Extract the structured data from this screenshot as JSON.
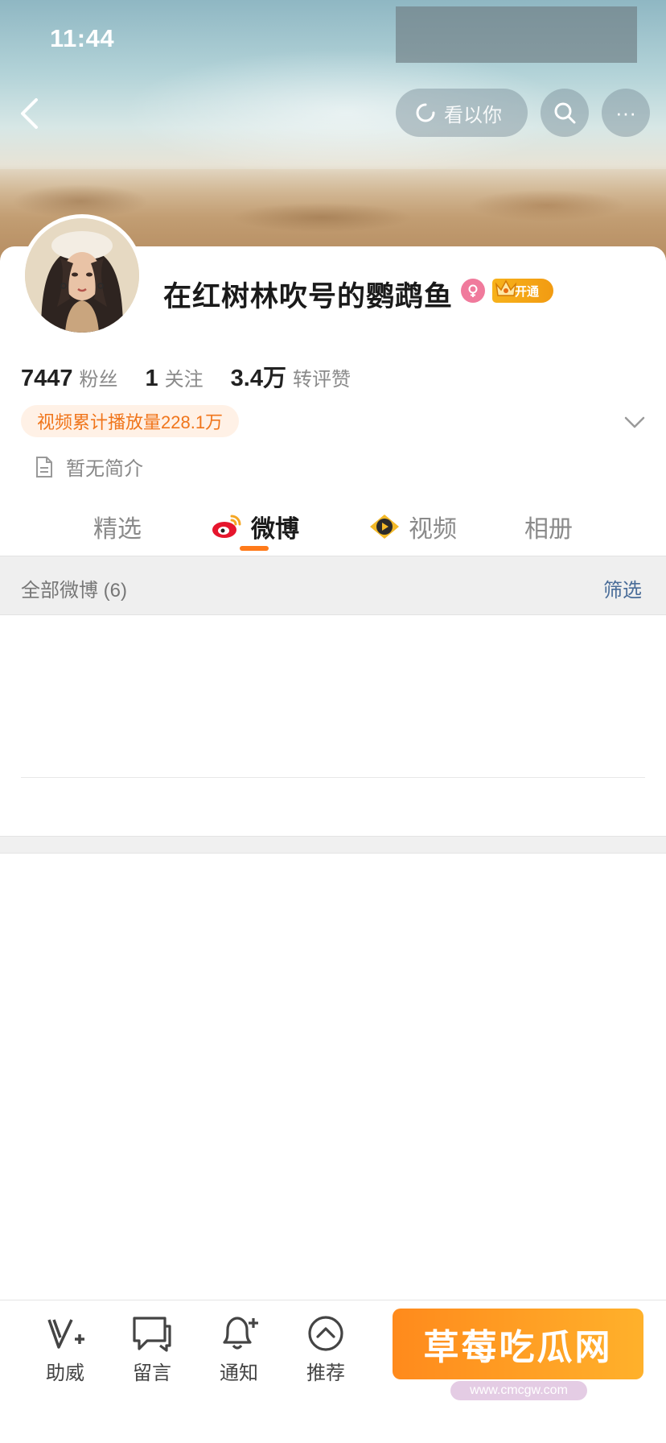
{
  "status_bar": {
    "time": "11:44"
  },
  "header": {
    "pill_label": "看以你",
    "more_label": "···"
  },
  "profile": {
    "name": "在红树林吹号的鹦鹉鱼",
    "vip_label": "开通",
    "stats": [
      {
        "value": "7447",
        "label": "粉丝"
      },
      {
        "value": "1",
        "label": "关注"
      },
      {
        "value": "3.4万",
        "label": "转评赞"
      }
    ],
    "video_plays": "视频累计播放量228.1万",
    "bio": "暂无简介"
  },
  "tabs": [
    {
      "label": "精选",
      "active": false
    },
    {
      "label": "微博",
      "active": true
    },
    {
      "label": "视频",
      "active": false
    },
    {
      "label": "相册",
      "active": false
    }
  ],
  "feed": {
    "all_posts": "全部微博 (6)",
    "filter": "筛选"
  },
  "bottom_bar": {
    "items": [
      {
        "label": "助威",
        "icon": "v-plus-icon"
      },
      {
        "label": "留言",
        "icon": "message-icon"
      },
      {
        "label": "通知",
        "icon": "bell-plus-icon"
      },
      {
        "label": "推荐",
        "icon": "chevron-up-circle-icon"
      }
    ],
    "cta_label": "草莓吃瓜网",
    "cta_sub": "www.cmcgw.com"
  },
  "colors": {
    "accent": "#ff7a1a",
    "link": "#4a6d99",
    "video_tag_text": "#f0751b",
    "gender": "#f07a9c",
    "vip": "#f7b21b"
  }
}
